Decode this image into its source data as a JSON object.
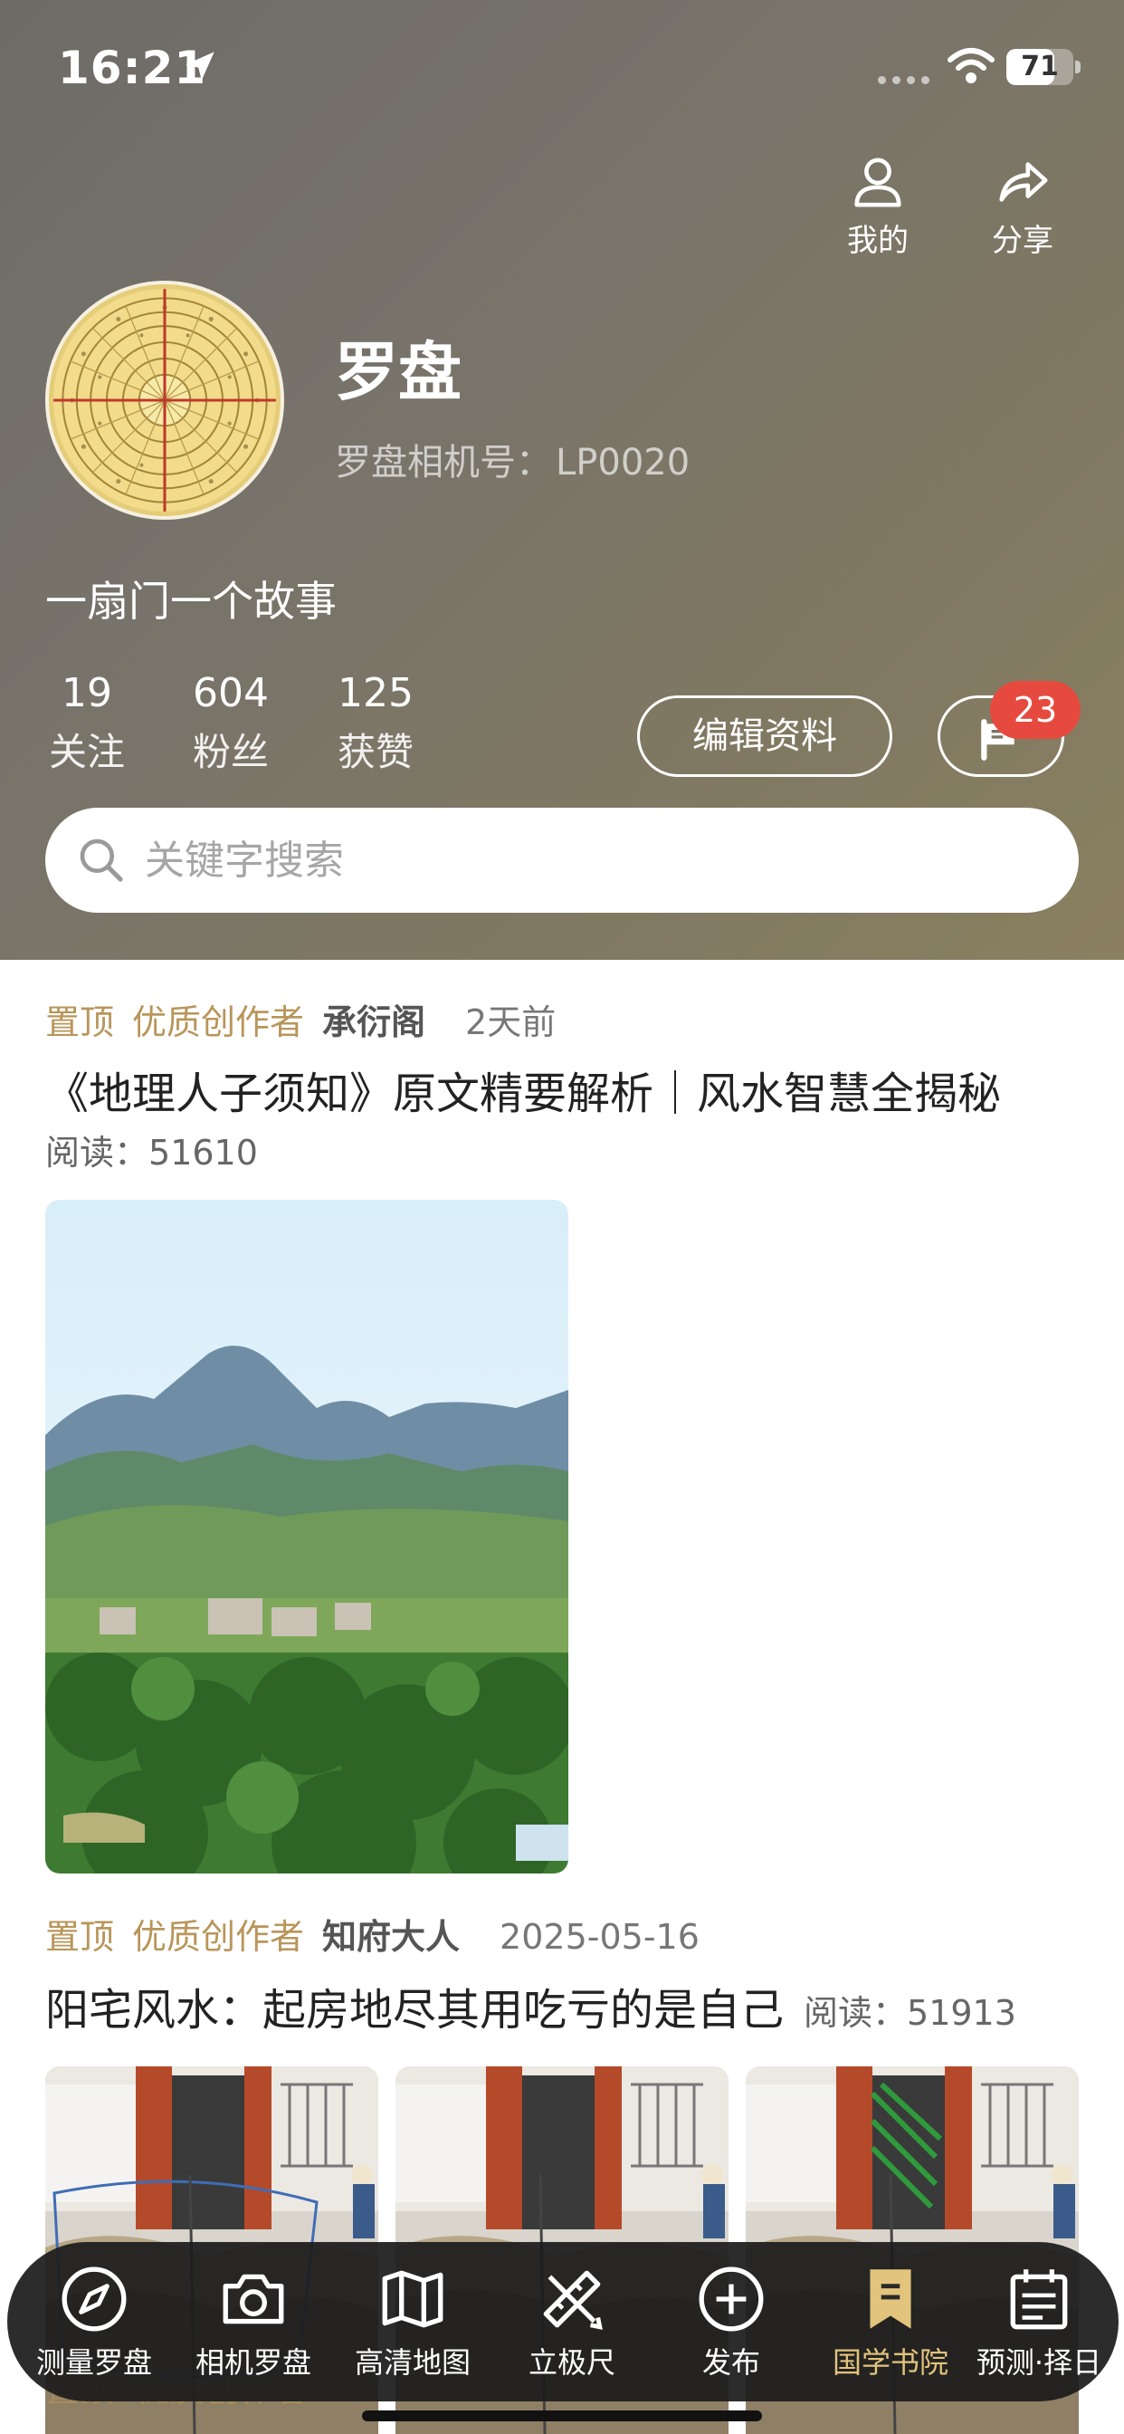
{
  "status_bar": {
    "time": "16:21",
    "battery": "71",
    "battery_level": 0.71
  },
  "header_actions": [
    {
      "label": "我的",
      "icon": "person-icon"
    },
    {
      "label": "分享",
      "icon": "share-icon"
    }
  ],
  "profile": {
    "name": "罗盘",
    "id_label": "罗盘相机号：",
    "id_value": "LP0020",
    "bio": "一扇门一个故事",
    "avatar_icon": "compass-icon"
  },
  "stats": [
    {
      "value": "19",
      "label": "关注"
    },
    {
      "value": "604",
      "label": "粉丝"
    },
    {
      "value": "125",
      "label": "获赞"
    }
  ],
  "edit_button": "编辑资料",
  "message_badge": "23",
  "search": {
    "placeholder": "关键字搜索",
    "value": ""
  },
  "posts": [
    {
      "tags": [
        "置顶",
        "优质创作者"
      ],
      "author": "承衍阁",
      "time": "2天前",
      "title": "《地理人子须知》原文精要解析｜风水智慧全揭秘",
      "read_label": "阅读：",
      "read_count": "51610"
    },
    {
      "tags": [
        "置顶",
        "优质创作者"
      ],
      "author": "知府大人",
      "time": "2025-05-16",
      "title": "阳宅风水：起房地尽其用吃亏的是自己",
      "read_label": "阅读：",
      "read_count": "51913"
    }
  ],
  "tabbar": [
    {
      "label": "测量罗盘",
      "icon": "compass-icon"
    },
    {
      "label": "相机罗盘",
      "icon": "camera-icon"
    },
    {
      "label": "高清地图",
      "icon": "map-icon"
    },
    {
      "label": "立极尺",
      "icon": "ruler-pencil-icon"
    },
    {
      "label": "发布",
      "icon": "plus-circle-icon"
    },
    {
      "label": "国学书院",
      "icon": "bookmark-icon",
      "active": true
    },
    {
      "label": "预测·择日",
      "icon": "calendar-icon"
    }
  ],
  "colors": {
    "accent": "#e2c47c",
    "tag": "#b8965a",
    "badge": "#e64a3e"
  }
}
